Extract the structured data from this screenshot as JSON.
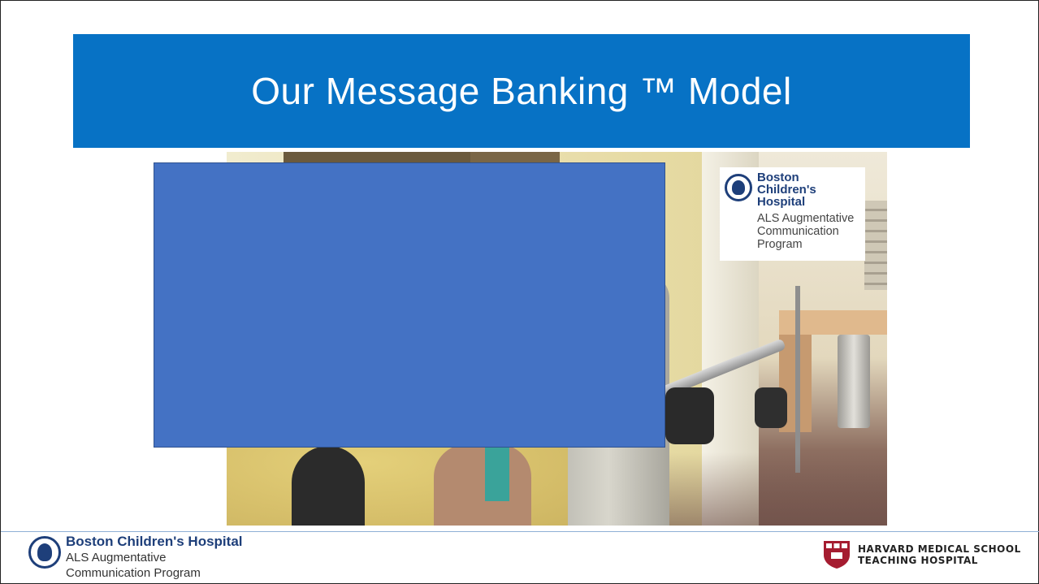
{
  "slide": {
    "title": "Our Message Banking ™ Model"
  },
  "video": {
    "overlay_logo": {
      "name": "Boston\nChildren's\nHospital",
      "program": "ALS Augmentative\nCommunication\nProgram"
    }
  },
  "footer": {
    "org_name": "Boston Children's Hospital",
    "program": "ALS Augmentative\nCommunication Program",
    "partner": "HARVARD MEDICAL SCHOOL\nTEACHING HOSPITAL"
  },
  "colors": {
    "title_band": "#0772c5",
    "placeholder_box": "#4472c4",
    "brand_navy": "#1e3f7a",
    "harvard_red": "#a51c30"
  },
  "icons": {
    "bch_seal": "boston-childrens-seal-icon",
    "harvard_shield": "harvard-veritas-shield-icon"
  }
}
